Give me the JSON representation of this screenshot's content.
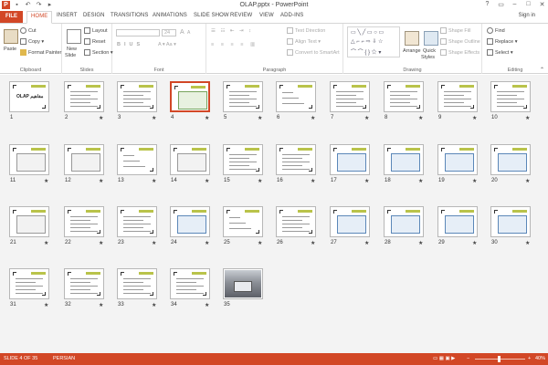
{
  "window": {
    "title": "OLAP.pptx - PowerPoint",
    "app_logo": "P",
    "qat": [
      "save-icon",
      "undo-icon",
      "redo-icon",
      "slideshow-icon"
    ],
    "controls": [
      "?",
      "▭",
      "–",
      "□",
      "✕"
    ]
  },
  "tabs": {
    "file": "FILE",
    "items": [
      "HOME",
      "INSERT",
      "DESIGN",
      "TRANSITIONS",
      "ANIMATIONS",
      "SLIDE SHOW",
      "REVIEW",
      "VIEW",
      "ADD-INS"
    ],
    "active": "HOME",
    "sign_in": "Sign in"
  },
  "ribbon": {
    "clipboard": {
      "label": "Clipboard",
      "paste": "Paste",
      "cut": "Cut",
      "copy": "Copy",
      "format_painter": "Format Painter"
    },
    "slides": {
      "label": "Slides",
      "new_slide": "New",
      "new_slide2": "Slide",
      "layout": "Layout",
      "reset": "Reset",
      "section": "Section"
    },
    "font": {
      "label": "Font",
      "size": "24",
      "size_up": "A",
      "size_down": "A"
    },
    "paragraph": {
      "label": "Paragraph",
      "text_direction": "Text Direction",
      "align_text": "Align Text",
      "convert_smartart": "Convert to SmartArt"
    },
    "drawing": {
      "label": "Drawing",
      "arrange": "Arrange",
      "quick_styles": "Quick",
      "quick_styles2": "Styles",
      "shape_fill": "Shape Fill",
      "shape_outline": "Shape Outline",
      "shape_effects": "Shape Effects"
    },
    "editing": {
      "label": "Editing",
      "find": "Find",
      "replace": "Replace",
      "select": "Select"
    }
  },
  "slides": [
    {
      "num": "1",
      "kind": "cover",
      "star": false,
      "cover_text": "OLAP مفاهیم"
    },
    {
      "num": "2",
      "kind": "text",
      "star": true
    },
    {
      "num": "3",
      "kind": "text",
      "star": true
    },
    {
      "num": "4",
      "kind": "table",
      "star": true,
      "selected": true
    },
    {
      "num": "5",
      "kind": "text",
      "star": true
    },
    {
      "num": "6",
      "kind": "diagram",
      "star": true
    },
    {
      "num": "7",
      "kind": "text",
      "star": true
    },
    {
      "num": "8",
      "kind": "text",
      "star": true
    },
    {
      "num": "9",
      "kind": "text",
      "star": true
    },
    {
      "num": "10",
      "kind": "text",
      "star": true
    },
    {
      "num": "11",
      "kind": "gtable",
      "star": true
    },
    {
      "num": "12",
      "kind": "gtable",
      "star": true
    },
    {
      "num": "13",
      "kind": "diagram",
      "star": true
    },
    {
      "num": "14",
      "kind": "gtable",
      "star": true
    },
    {
      "num": "15",
      "kind": "text",
      "star": true
    },
    {
      "num": "16",
      "kind": "text",
      "star": true
    },
    {
      "num": "17",
      "kind": "btable",
      "star": true
    },
    {
      "num": "18",
      "kind": "btable",
      "star": true
    },
    {
      "num": "19",
      "kind": "btable",
      "star": true
    },
    {
      "num": "20",
      "kind": "btable",
      "star": true
    },
    {
      "num": "21",
      "kind": "gtable",
      "star": true
    },
    {
      "num": "22",
      "kind": "text",
      "star": true
    },
    {
      "num": "23",
      "kind": "text",
      "star": true
    },
    {
      "num": "24",
      "kind": "btable",
      "star": true
    },
    {
      "num": "25",
      "kind": "diagram",
      "star": true
    },
    {
      "num": "26",
      "kind": "text",
      "star": true
    },
    {
      "num": "27",
      "kind": "btable",
      "star": true
    },
    {
      "num": "28",
      "kind": "btable",
      "star": true
    },
    {
      "num": "29",
      "kind": "btable",
      "star": true
    },
    {
      "num": "30",
      "kind": "btable",
      "star": true
    },
    {
      "num": "31",
      "kind": "text",
      "star": true
    },
    {
      "num": "32",
      "kind": "text",
      "star": true
    },
    {
      "num": "33",
      "kind": "text",
      "star": true
    },
    {
      "num": "34",
      "kind": "text",
      "star": true
    },
    {
      "num": "35",
      "kind": "photo",
      "star": false
    }
  ],
  "status": {
    "slide": "SLIDE 4 OF 35",
    "language": "PERSIAN",
    "zoom": "40%",
    "zoom_minus": "−",
    "zoom_plus": "+"
  }
}
